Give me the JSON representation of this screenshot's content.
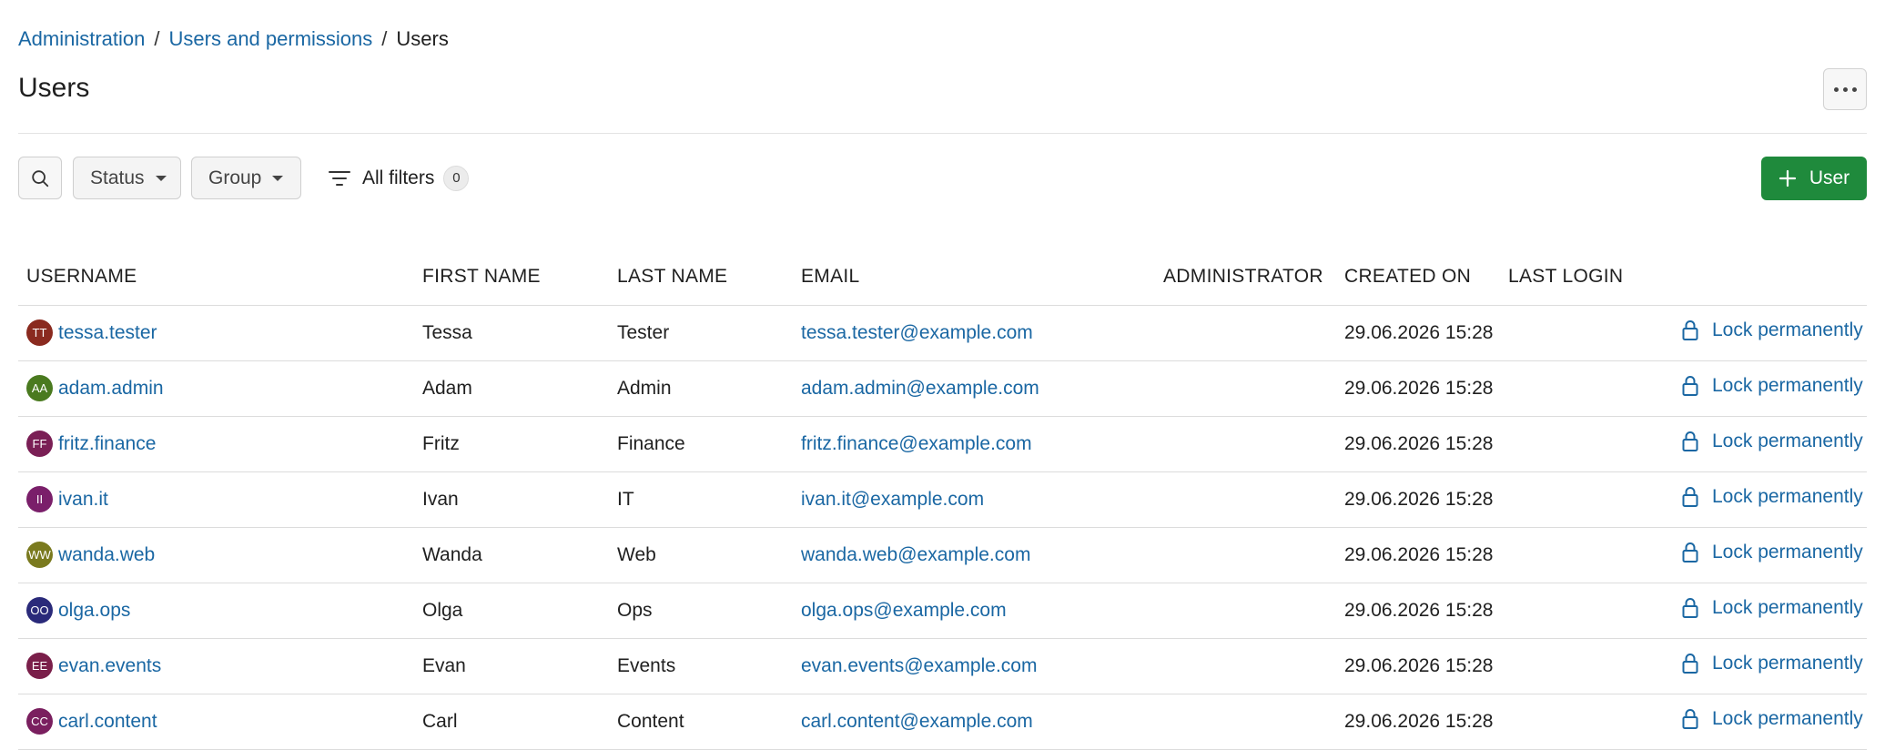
{
  "breadcrumb": {
    "items": [
      "Administration",
      "Users and permissions"
    ],
    "current": "Users",
    "separator": "/"
  },
  "page": {
    "title": "Users",
    "more_icon": "ellipsis-icon"
  },
  "toolbar": {
    "search_icon": "search-icon",
    "status_label": "Status",
    "group_label": "Group",
    "all_filters_label": "All filters",
    "filter_count": "0",
    "add_user_label": "User",
    "add_user_color": "#1f8a3c"
  },
  "table": {
    "columns": [
      "USERNAME",
      "FIRST NAME",
      "LAST NAME",
      "EMAIL",
      "ADMINISTRATOR",
      "CREATED ON",
      "LAST LOGIN"
    ],
    "action_label": "Lock permanently",
    "rows": [
      {
        "initials": "TT",
        "avatar_color": "#8a2a1f",
        "username": "tessa.tester",
        "first": "Tessa",
        "last": "Tester",
        "email": "tessa.tester@example.com",
        "admin": "",
        "created": "29.06.2026 15:28",
        "last_login": ""
      },
      {
        "initials": "AA",
        "avatar_color": "#4a7a1f",
        "username": "adam.admin",
        "first": "Adam",
        "last": "Admin",
        "email": "adam.admin@example.com",
        "admin": "",
        "created": "29.06.2026 15:28",
        "last_login": ""
      },
      {
        "initials": "FF",
        "avatar_color": "#7a1f55",
        "username": "fritz.finance",
        "first": "Fritz",
        "last": "Finance",
        "email": "fritz.finance@example.com",
        "admin": "",
        "created": "29.06.2026 15:28",
        "last_login": ""
      },
      {
        "initials": "II",
        "avatar_color": "#7a1f6a",
        "username": "ivan.it",
        "first": "Ivan",
        "last": "IT",
        "email": "ivan.it@example.com",
        "admin": "",
        "created": "29.06.2026 15:28",
        "last_login": ""
      },
      {
        "initials": "WW",
        "avatar_color": "#7a7a1f",
        "username": "wanda.web",
        "first": "Wanda",
        "last": "Web",
        "email": "wanda.web@example.com",
        "admin": "",
        "created": "29.06.2026 15:28",
        "last_login": ""
      },
      {
        "initials": "OO",
        "avatar_color": "#2a2a7a",
        "username": "olga.ops",
        "first": "Olga",
        "last": "Ops",
        "email": "olga.ops@example.com",
        "admin": "",
        "created": "29.06.2026 15:28",
        "last_login": ""
      },
      {
        "initials": "EE",
        "avatar_color": "#7a1f4a",
        "username": "evan.events",
        "first": "Evan",
        "last": "Events",
        "email": "evan.events@example.com",
        "admin": "",
        "created": "29.06.2026 15:28",
        "last_login": ""
      },
      {
        "initials": "CC",
        "avatar_color": "#7a1f5f",
        "username": "carl.content",
        "first": "Carl",
        "last": "Content",
        "email": "carl.content@example.com",
        "admin": "",
        "created": "29.06.2026 15:28",
        "last_login": ""
      }
    ]
  },
  "colors": {
    "link": "#1a67a3",
    "accent": "#1f8a3c"
  }
}
